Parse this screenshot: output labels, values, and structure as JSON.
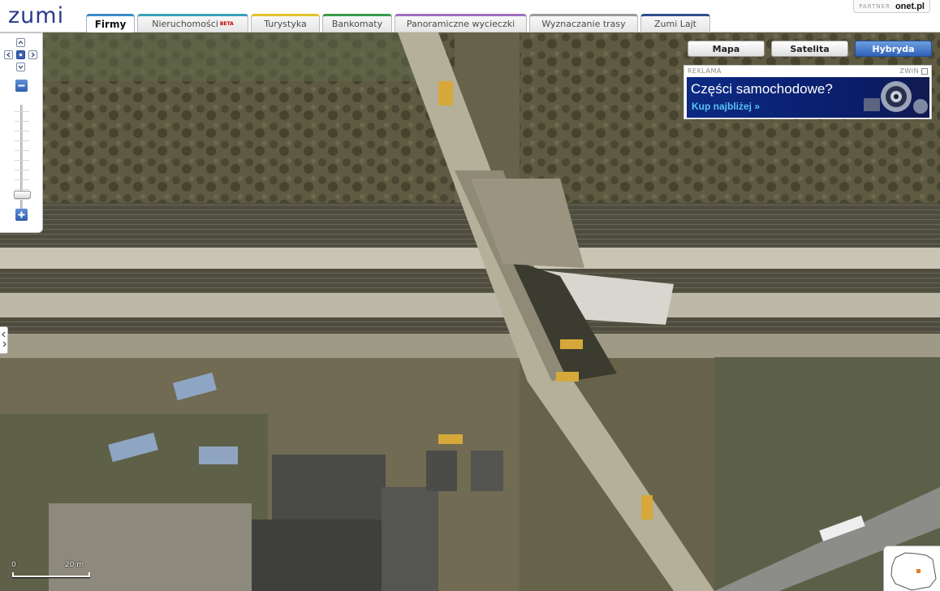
{
  "header": {
    "logo_text": "zumi",
    "partner_label": "PARTNER",
    "partner_name": "onet.pl"
  },
  "tabs": [
    {
      "label": "Firmy",
      "active": true,
      "color": "#3a8bc8"
    },
    {
      "label": "Nieruchomości",
      "badge": "BETA",
      "color": "#3aa0b8"
    },
    {
      "label": "Turystyka",
      "color": "#e1c22a"
    },
    {
      "label": "Bankomaty",
      "color": "#3a9a4a"
    },
    {
      "label": "Panoramiczne wycieczki",
      "color": "#a070c0"
    },
    {
      "label": "Wyznaczanie trasy",
      "color": "#9a9a9a"
    },
    {
      "label": "Zumi Lajt",
      "color": "#2f4f8f"
    }
  ],
  "map_types": [
    {
      "label": "Mapa"
    },
    {
      "label": "Satelita"
    },
    {
      "label": "Hybryda",
      "active": true
    }
  ],
  "ad": {
    "label": "REKLAMA",
    "collapse_label": "ZWIŃ",
    "title": "Części samochodowe?",
    "cta": "Kup najbliżej »"
  },
  "scale": {
    "start": "0",
    "end": "20 m"
  },
  "zoom": {
    "level_fraction": 0.85
  },
  "colors": {
    "accent": "#2f62b8",
    "ad_bg": "#0c2a84",
    "ad_cta": "#58c4f5"
  }
}
